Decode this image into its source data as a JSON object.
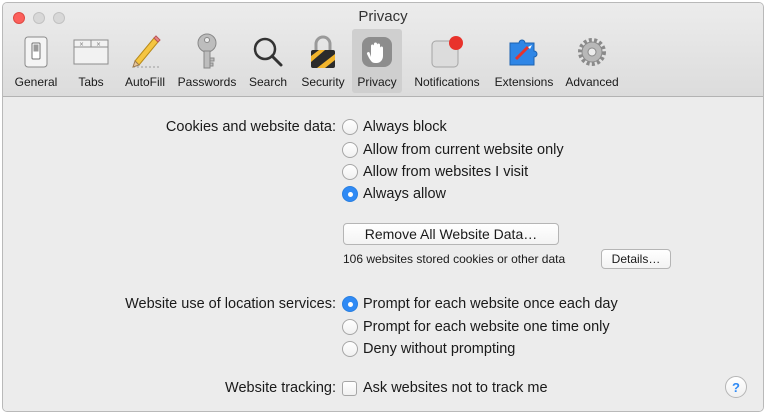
{
  "window": {
    "title": "Privacy"
  },
  "toolbar": {
    "items": [
      {
        "label": "General",
        "icon": "general-switch-icon"
      },
      {
        "label": "Tabs",
        "icon": "tabs-icon"
      },
      {
        "label": "AutoFill",
        "icon": "pencil-icon"
      },
      {
        "label": "Passwords",
        "icon": "key-icon"
      },
      {
        "label": "Search",
        "icon": "magnifier-icon"
      },
      {
        "label": "Security",
        "icon": "padlock-icon"
      },
      {
        "label": "Privacy",
        "icon": "hand-icon",
        "selected": true
      },
      {
        "label": "Notifications",
        "icon": "notification-badge-icon"
      },
      {
        "label": "Extensions",
        "icon": "puzzle-icon"
      },
      {
        "label": "Advanced",
        "icon": "gears-icon"
      }
    ]
  },
  "cookies": {
    "label": "Cookies and website data:",
    "options": [
      {
        "label": "Always block",
        "selected": false
      },
      {
        "label": "Allow from current website only",
        "selected": false
      },
      {
        "label": "Allow from websites I visit",
        "selected": false
      },
      {
        "label": "Always allow",
        "selected": true
      }
    ],
    "remove_button": "Remove All Website Data…",
    "stored_note": "106 websites stored cookies or other data",
    "details_button": "Details…"
  },
  "location": {
    "label": "Website use of location services:",
    "options": [
      {
        "label": "Prompt for each website once each day",
        "selected": true
      },
      {
        "label": "Prompt for each website one time only",
        "selected": false
      },
      {
        "label": "Deny without prompting",
        "selected": false
      }
    ]
  },
  "tracking": {
    "label": "Website tracking:",
    "checkbox_label": "Ask websites not to track me",
    "checked": false
  },
  "help": {
    "label": "?"
  },
  "colors": {
    "accent": "#2f8af5",
    "close": "#fc605c"
  }
}
